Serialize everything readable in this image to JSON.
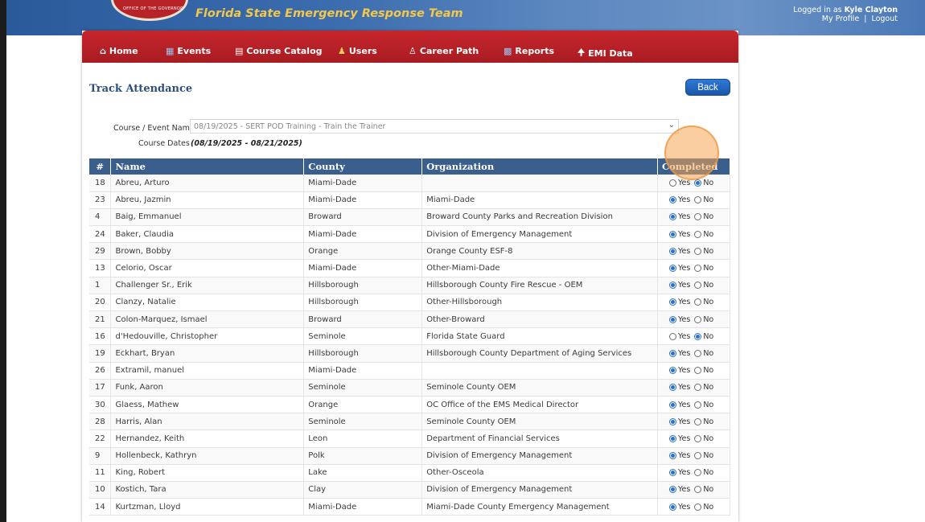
{
  "header": {
    "site_title": "Florida State Emergency Response Team",
    "seal_text": "OFFICE OF THE GOVERNOR",
    "logged_in_prefix": "Logged in as",
    "user_name": "Kyle Clayton",
    "profile_link": "My Profile",
    "separator": "|",
    "logout_link": "Logout"
  },
  "nav": [
    {
      "label": "Home",
      "icon": "home-icon"
    },
    {
      "label": "Events",
      "icon": "events-icon"
    },
    {
      "label": "Course Catalog",
      "icon": "book-icon"
    },
    {
      "label": "Users",
      "icon": "users-icon"
    },
    {
      "label": "Career Path",
      "icon": "career-path-icon"
    },
    {
      "label": "Reports",
      "icon": "reports-icon"
    },
    {
      "label": "EMI Data",
      "icon": "up-arrow-icon"
    }
  ],
  "page": {
    "title": "Track Attendance",
    "back_label": "Back",
    "course_label": "Course / Event Name",
    "course_value": "08/19/2025 - SERT POD Training - Train the Trainer",
    "dates_label": "Course Dates",
    "dates_value": "(08/19/2025 - 08/21/2025)"
  },
  "table": {
    "headers": [
      "#",
      "Name",
      "County",
      "Organization",
      "Completed"
    ],
    "yes_label": "Yes",
    "no_label": "No",
    "rows": [
      {
        "num": "18",
        "name": "Abreu, Arturo",
        "county": "Miami-Dade",
        "org": "",
        "completed": false
      },
      {
        "num": "23",
        "name": "Abreu, Jazmin",
        "county": "Miami-Dade",
        "org": "Miami-Dade",
        "completed": true
      },
      {
        "num": "4",
        "name": "Baig, Emmanuel",
        "county": "Broward",
        "org": "Broward County Parks and Recreation Division",
        "completed": true
      },
      {
        "num": "24",
        "name": "Baker, Claudia",
        "county": "Miami-Dade",
        "org": "Division of Emergency Management",
        "completed": true
      },
      {
        "num": "29",
        "name": "Brown, Bobby",
        "county": "Orange",
        "org": "Orange County ESF-8",
        "completed": true
      },
      {
        "num": "13",
        "name": "Celorio, Oscar",
        "county": "Miami-Dade",
        "org": "Other-Miami-Dade",
        "completed": true
      },
      {
        "num": "1",
        "name": "Challenger Sr., Erik",
        "county": "Hillsborough",
        "org": "Hillsborough County Fire Rescue - OEM",
        "completed": true
      },
      {
        "num": "20",
        "name": "Clanzy, Natalie",
        "county": "Hillsborough",
        "org": "Other-Hillsborough",
        "completed": true
      },
      {
        "num": "21",
        "name": "Colon-Marquez, Ismael",
        "county": "Broward",
        "org": "Other-Broward",
        "completed": true
      },
      {
        "num": "16",
        "name": "d'Hedouville, Christopher",
        "county": "Seminole",
        "org": "Florida State Guard",
        "completed": false
      },
      {
        "num": "19",
        "name": "Eckhart, Bryan",
        "county": "Hillsborough",
        "org": "Hillsborough County Department of Aging Services",
        "completed": true
      },
      {
        "num": "26",
        "name": "Extramil, manuel",
        "county": "Miami-Dade",
        "org": "",
        "completed": true
      },
      {
        "num": "17",
        "name": "Funk, Aaron",
        "county": "Seminole",
        "org": "Seminole County OEM",
        "completed": true
      },
      {
        "num": "30",
        "name": "Glaess, Mathew",
        "county": "Orange",
        "org": "OC Office of the EMS Medical Director",
        "completed": true
      },
      {
        "num": "28",
        "name": "Harris, Alan",
        "county": "Seminole",
        "org": "Seminole County OEM",
        "completed": true
      },
      {
        "num": "22",
        "name": "Hernandez, Keith",
        "county": "Leon",
        "org": "Department of Financial Services",
        "completed": true
      },
      {
        "num": "9",
        "name": "Hollenbeck, Kathryn",
        "county": "Polk",
        "org": "Division of Emergency Management",
        "completed": true
      },
      {
        "num": "11",
        "name": "King, Robert",
        "county": "Lake",
        "org": "Other-Osceola",
        "completed": true
      },
      {
        "num": "10",
        "name": "Kostich, Tara",
        "county": "Clay",
        "org": "Division of Emergency Management",
        "completed": true
      },
      {
        "num": "14",
        "name": "Kurtzman, Lloyd",
        "county": "Miami-Dade",
        "org": "Miami-Dade County Emergency Management",
        "completed": true
      }
    ]
  }
}
